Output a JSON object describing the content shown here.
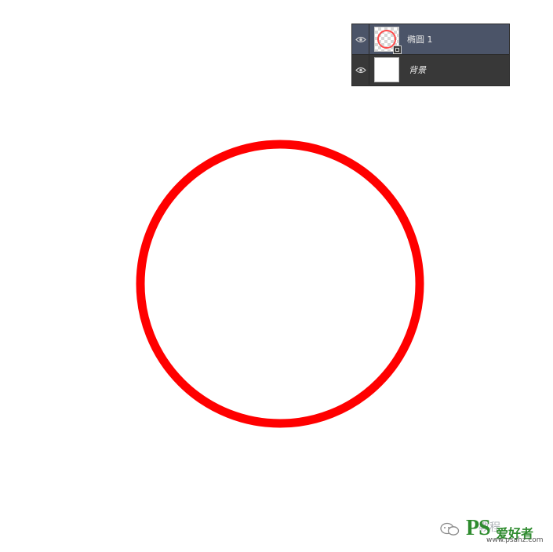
{
  "canvas": {
    "shape": "circle-outline",
    "stroke_color": "#ff0000",
    "background": "#ffffff"
  },
  "layers_panel": {
    "layers": [
      {
        "name": "椭圆 1",
        "visible": true,
        "selected": true,
        "thumbnail": "shape-layer-thumbnail"
      },
      {
        "name": "背景",
        "visible": true,
        "selected": false,
        "thumbnail": "white-background-thumbnail"
      }
    ],
    "selected_color": "#4b5468",
    "panel_color": "#3a3a3a"
  },
  "watermark": {
    "faint_text": "教程",
    "brand": "PS",
    "brand_cn": "爱好者",
    "url": "www.psahz.com",
    "brand_color": "#2e8b2e"
  }
}
